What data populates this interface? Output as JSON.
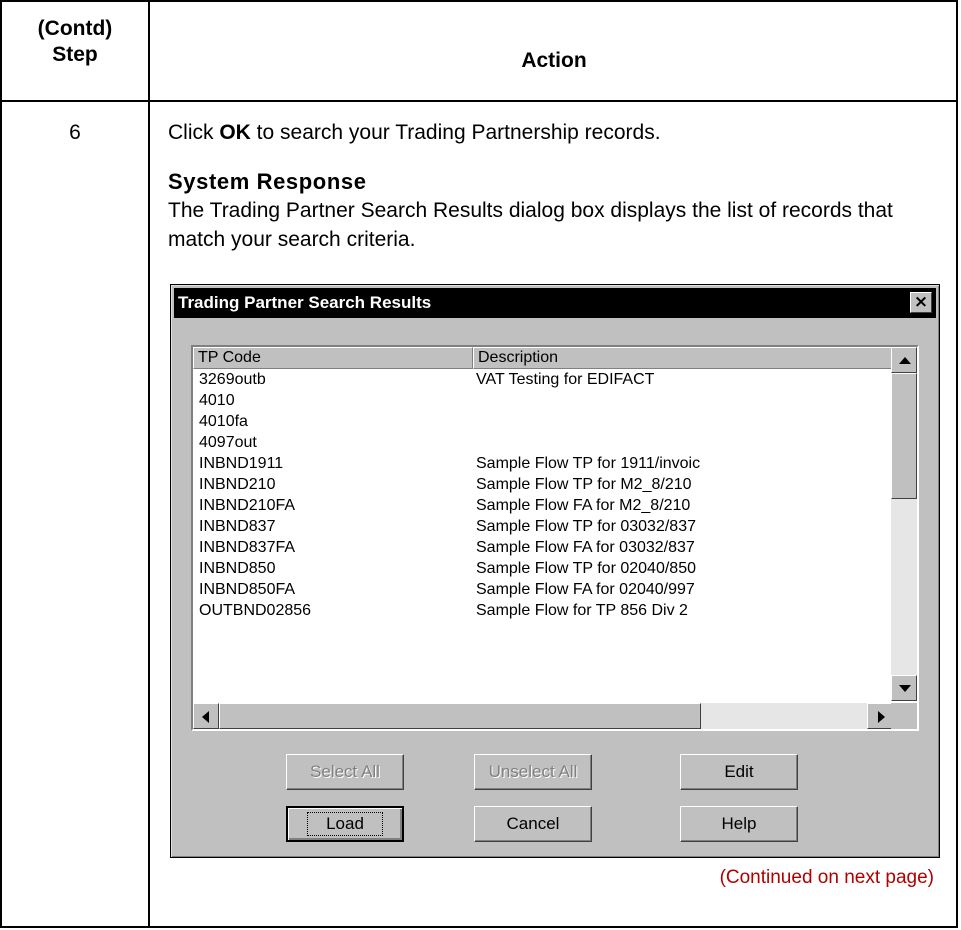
{
  "table": {
    "header_step_line1": "(Contd)",
    "header_step_line2": "Step",
    "header_action": "Action",
    "step_number": "6",
    "instruction_prefix": "Click ",
    "instruction_bold": "OK",
    "instruction_suffix": " to search your Trading Partnership records.",
    "response_heading": "System Response",
    "response_text": "The Trading Partner Search Results dialog box displays the list of records that match your search criteria.",
    "continued": "(Continued on next page)"
  },
  "dialog": {
    "title": "Trading Partner Search Results",
    "close_glyph": "×",
    "columns": [
      "TP Code",
      "Description"
    ],
    "rows": [
      {
        "code": "3269outb",
        "description": "VAT Testing for EDIFACT"
      },
      {
        "code": "4010",
        "description": ""
      },
      {
        "code": "4010fa",
        "description": ""
      },
      {
        "code": "4097out",
        "description": ""
      },
      {
        "code": "INBND1911",
        "description": "Sample Flow TP for 1911/invoic"
      },
      {
        "code": "INBND210",
        "description": "Sample Flow TP for M2_8/210"
      },
      {
        "code": "INBND210FA",
        "description": "Sample Flow FA for M2_8/210"
      },
      {
        "code": "INBND837",
        "description": "Sample Flow TP for 03032/837"
      },
      {
        "code": "INBND837FA",
        "description": "Sample Flow FA for 03032/837"
      },
      {
        "code": "INBND850",
        "description": "Sample Flow TP for 02040/850"
      },
      {
        "code": "INBND850FA",
        "description": "Sample Flow FA for 02040/997"
      },
      {
        "code": "OUTBND02856",
        "description": "Sample Flow for TP 856 Div 2"
      }
    ],
    "buttons": {
      "select_all": "Select All",
      "unselect_all": "Unselect All",
      "edit": "Edit",
      "load": "Load",
      "cancel": "Cancel",
      "help": "Help"
    }
  }
}
